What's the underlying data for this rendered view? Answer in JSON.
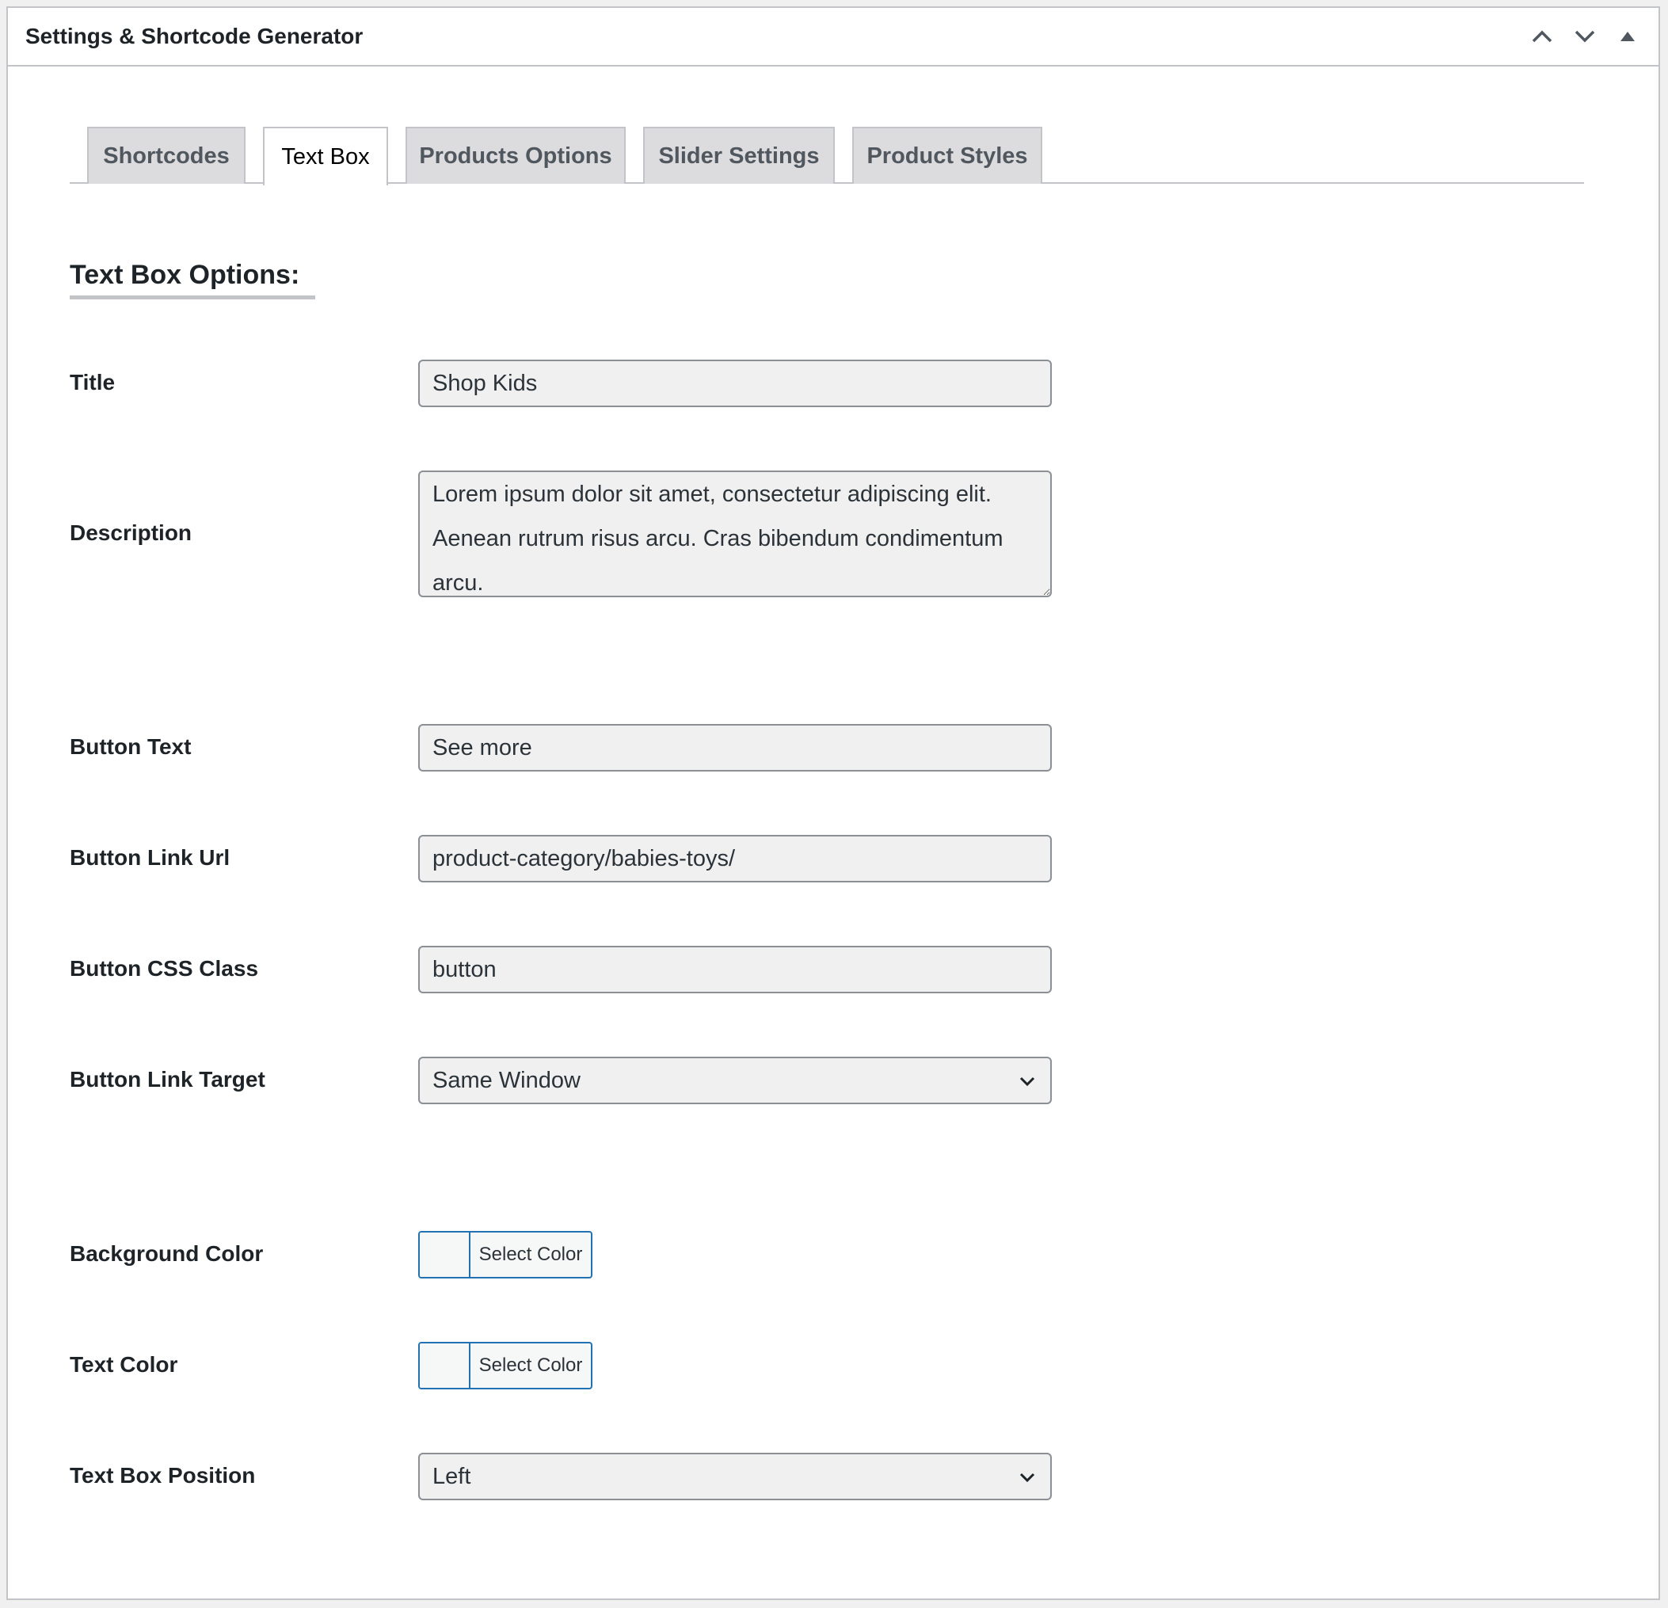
{
  "panel": {
    "title": "Settings & Shortcode Generator",
    "controls": [
      "move-up-icon",
      "move-down-icon",
      "collapse-toggle-icon"
    ]
  },
  "tabs": [
    {
      "label": "Shortcodes",
      "active": false
    },
    {
      "label": "Text Box",
      "active": true
    },
    {
      "label": "Products Options",
      "active": false
    },
    {
      "label": "Slider Settings",
      "active": false
    },
    {
      "label": "Product Styles",
      "active": false
    }
  ],
  "section": {
    "title": "Text Box Options:"
  },
  "fields": {
    "title": {
      "label": "Title",
      "value": "Shop Kids"
    },
    "description": {
      "label": "Description",
      "value": "Lorem ipsum dolor sit amet, consectetur adipiscing elit. Aenean rutrum risus arcu. Cras bibendum condimentum arcu."
    },
    "button_text": {
      "label": "Button Text",
      "value": "See more"
    },
    "button_link_url": {
      "label": "Button Link Url",
      "value": "product-category/babies-toys/"
    },
    "button_css_class": {
      "label": "Button CSS Class",
      "value": "button"
    },
    "button_link_target": {
      "label": "Button Link Target",
      "value": "Same Window"
    },
    "background_color": {
      "label": "Background Color",
      "button_label": "Select Color"
    },
    "text_color": {
      "label": "Text Color",
      "button_label": "Select Color"
    },
    "text_box_position": {
      "label": "Text Box Position",
      "value": "Left"
    }
  },
  "colors": {
    "accent": "#2271b1",
    "border": "#c3c4c7",
    "field_bg": "#f0f0f1"
  }
}
